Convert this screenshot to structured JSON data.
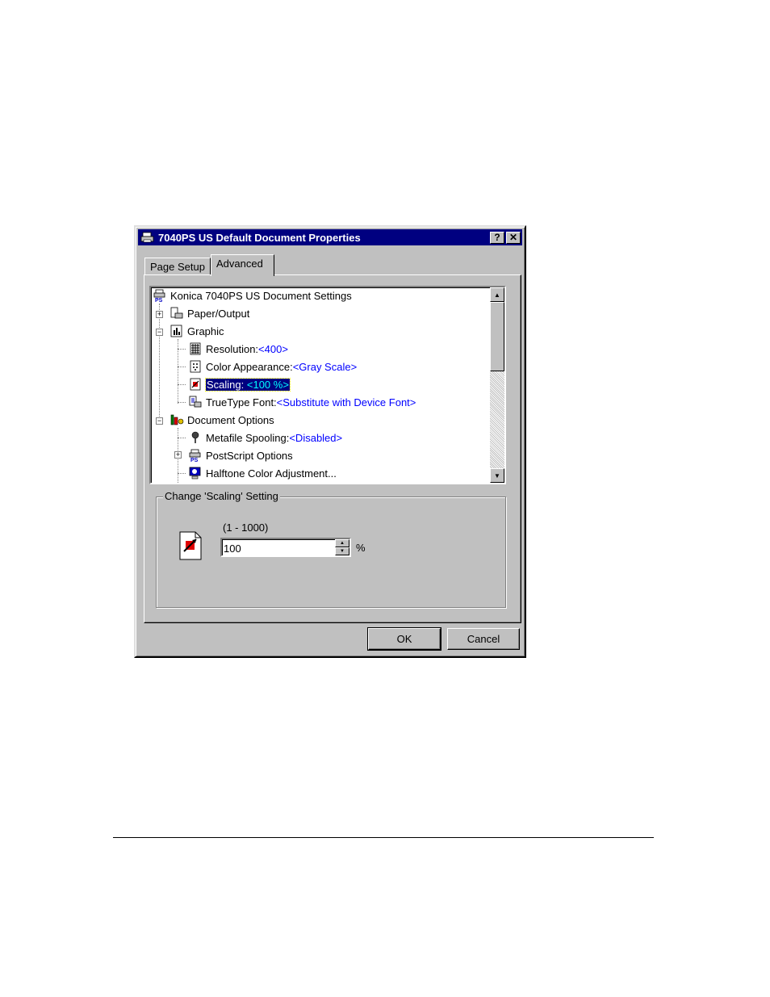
{
  "window": {
    "title": "7040PS US Default Document Properties",
    "help_glyph": "?",
    "close_glyph": "✕"
  },
  "tabs": [
    {
      "label": "Page Setup"
    },
    {
      "label": "Advanced"
    }
  ],
  "tree": {
    "root": "Konica 7040PS US Document Settings",
    "paper_output": "Paper/Output",
    "graphic": "Graphic",
    "resolution_label": "Resolution: ",
    "resolution_value": "<400>",
    "color_label": "Color Appearance: ",
    "color_value": "<Gray Scale>",
    "scaling_label": "Scaling: ",
    "scaling_value": "<100 %>",
    "truetype_label": "TrueType Font: ",
    "truetype_value": "<Substitute with Device Font>",
    "document_options": "Document Options",
    "metafile_label": "Metafile Spooling: ",
    "metafile_value": "<Disabled>",
    "postscript_options": "PostScript Options",
    "halftone": "Halftone Color Adjustment..."
  },
  "group": {
    "label": "Change 'Scaling' Setting",
    "range": "(1 - 1000)",
    "value": "100",
    "unit": "%"
  },
  "buttons": {
    "ok": "OK",
    "cancel": "Cancel"
  },
  "colors": {
    "titlebar": "#000080",
    "face": "#c0c0c0",
    "value_text": "#0000ff"
  }
}
